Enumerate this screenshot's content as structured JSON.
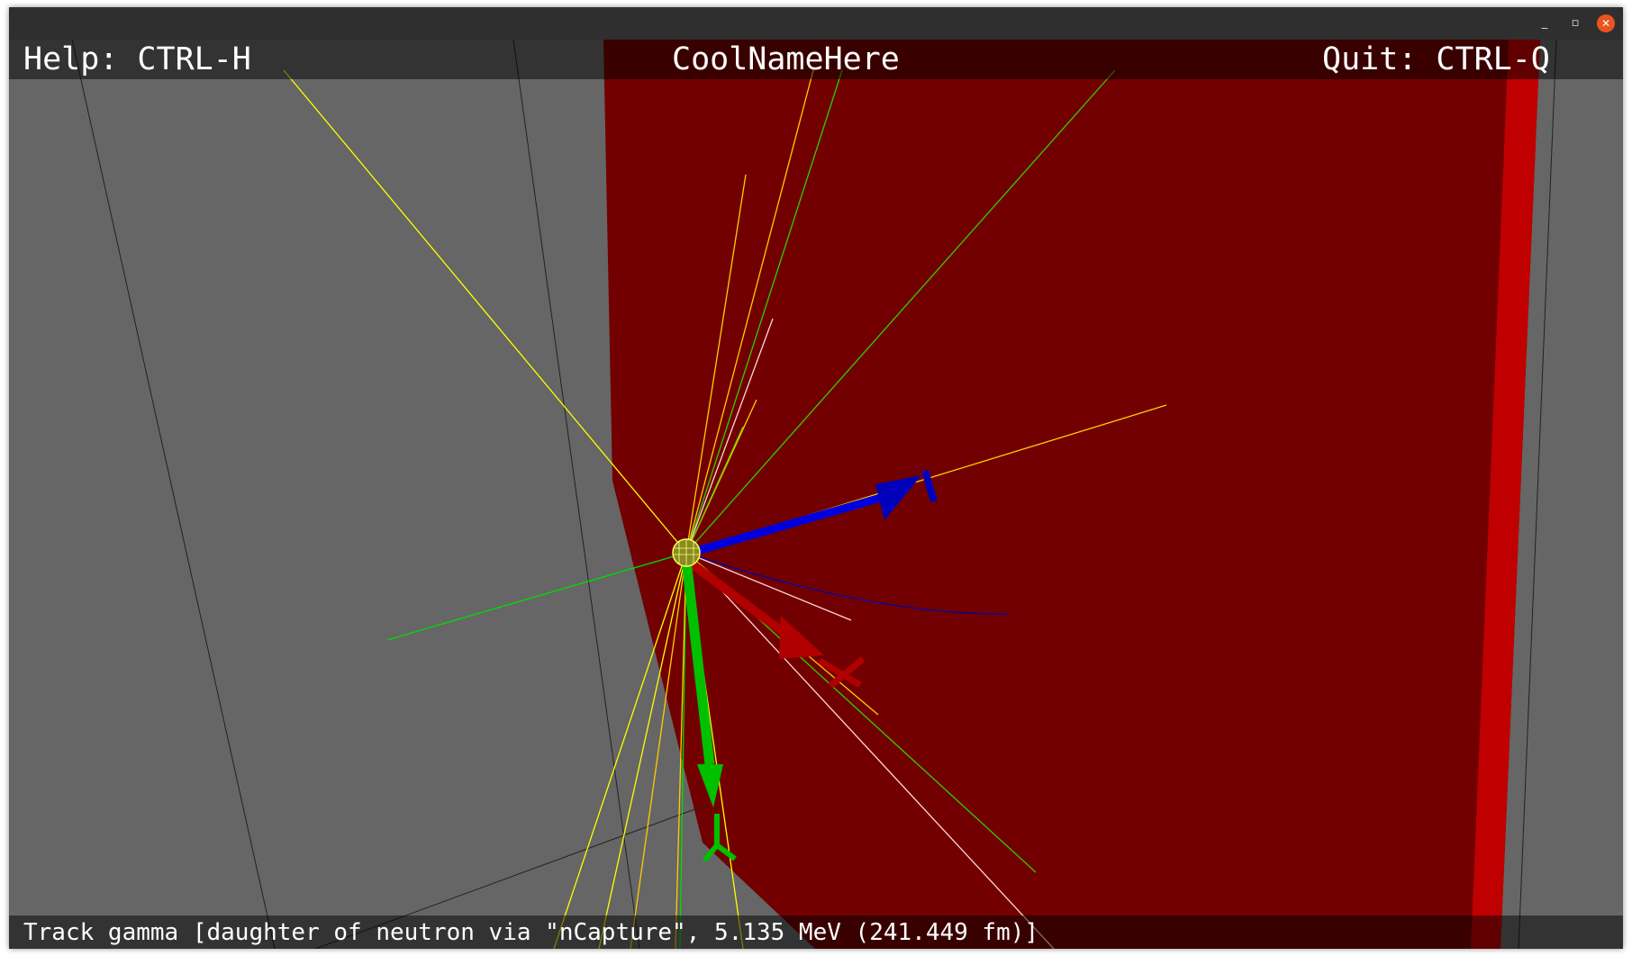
{
  "window": {
    "controls": {
      "minimize": "_",
      "maximize": "▫",
      "close": "✕"
    }
  },
  "hud": {
    "help": "Help: CTRL-H",
    "title": "CoolNameHere",
    "quit": "Quit: CTRL-Q",
    "status": "Track gamma [daughter of neutron via \"nCapture\", 5.135 MeV (241.449 fm)]"
  },
  "colors": {
    "background_gray": "#666666",
    "detector_red": "#720000",
    "detector_edge_red": "#c00000",
    "track_gamma": "#ffff00",
    "track_green": "#00dd00",
    "axis_x": "#cc0000",
    "axis_y": "#00cc00",
    "axis_z": "#0000cc",
    "track_white": "#ffd7d7",
    "track_blue": "#0000aa"
  }
}
